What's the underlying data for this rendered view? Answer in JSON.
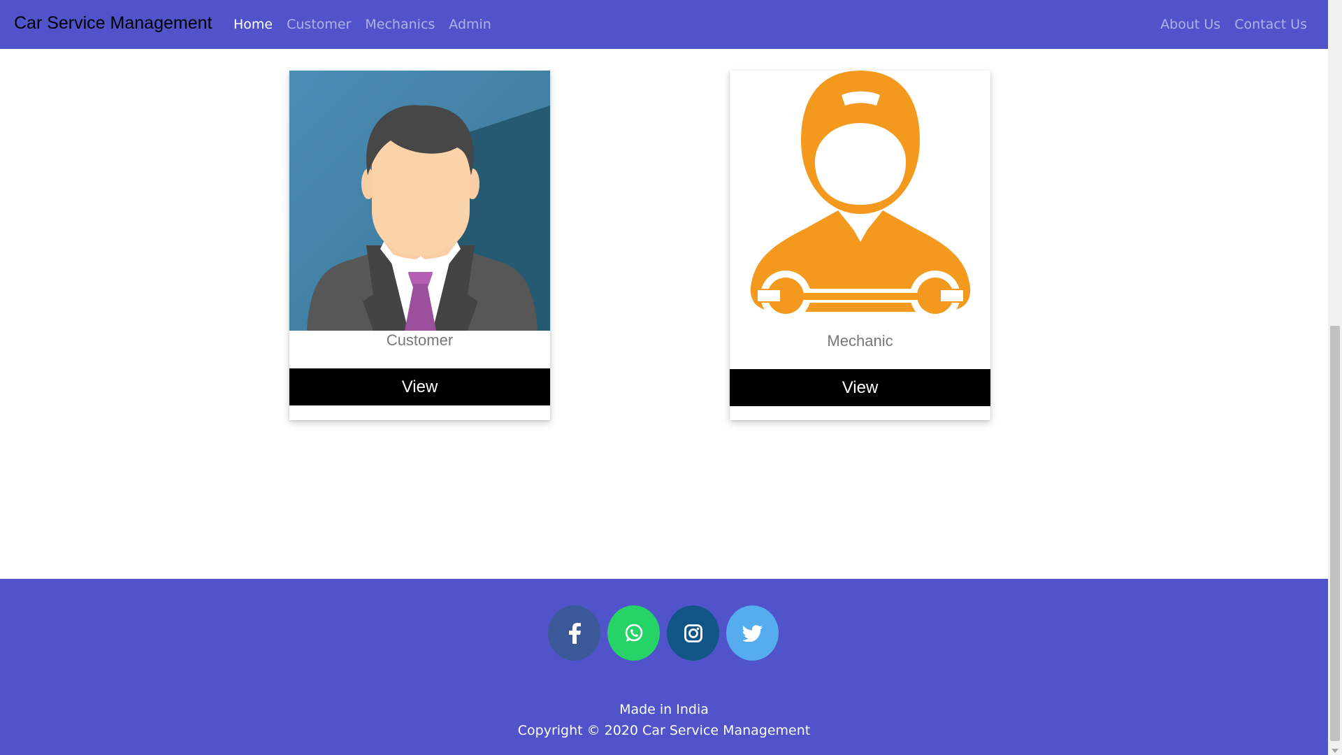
{
  "navbar": {
    "brand": "Car Service Management",
    "left_links": [
      "Home",
      "Customer",
      "Mechanics",
      "Admin"
    ],
    "right_links": [
      "About Us",
      "Contact Us"
    ],
    "active": "Home",
    "background": "#5053c9"
  },
  "cards": [
    {
      "label": "Customer",
      "button": "View",
      "image_icon": "businessman-avatar-icon"
    },
    {
      "label": "Mechanic",
      "button": "View",
      "image_icon": "mechanic-wrench-icon"
    }
  ],
  "footer": {
    "social": [
      {
        "name": "facebook-icon",
        "color": "#3b5998"
      },
      {
        "name": "whatsapp-icon",
        "color": "#25d366"
      },
      {
        "name": "instagram-icon",
        "color": "#125688"
      },
      {
        "name": "twitter-icon",
        "color": "#55acee"
      }
    ],
    "made_in": "Made in India",
    "copyright": "Copyright © 2020 Car Service Management"
  }
}
